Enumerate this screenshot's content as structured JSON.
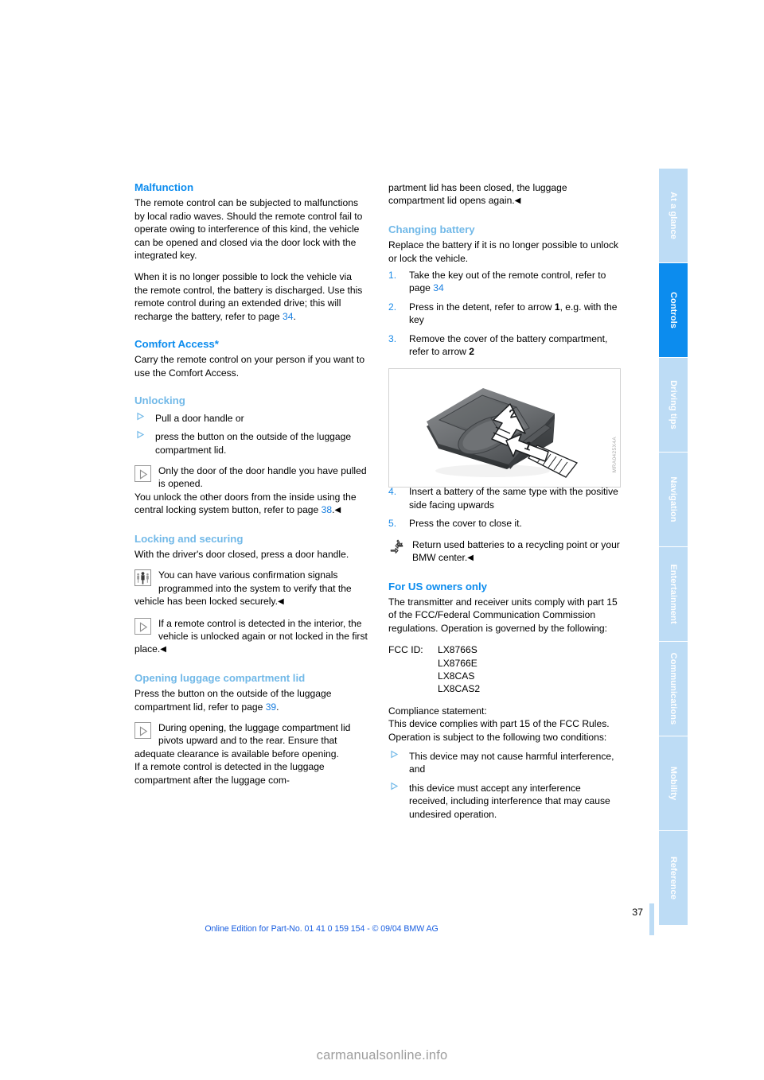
{
  "document": {
    "page_number": "37",
    "footer_note": "Online Edition for Part-No. 01 41 0 159 154 - © 09/04 BMW AG",
    "watermark": "carmanualsonline.info"
  },
  "colors": {
    "heading_primary": "#0c8cee",
    "heading_secondary": "#72b9e8",
    "page_ref_link": "#1a7fe0",
    "tab_active_bg": "#0c8cee",
    "tab_inactive_bg": "#bddcf5",
    "body_text": "#000000",
    "watermark": "#9d9d9d"
  },
  "sidebar": {
    "tabs": [
      {
        "label": "At a glance",
        "active": false
      },
      {
        "label": "Controls",
        "active": true
      },
      {
        "label": "Driving tips",
        "active": false
      },
      {
        "label": "Navigation",
        "active": false
      },
      {
        "label": "Entertainment",
        "active": false
      },
      {
        "label": "Communications",
        "active": false
      },
      {
        "label": "Mobility",
        "active": false
      },
      {
        "label": "Reference",
        "active": false
      }
    ]
  },
  "left_column": {
    "malfunction": {
      "heading": "Malfunction",
      "para1": "The remote control can be subjected to malfunctions by local radio waves. Should the remote control fail to operate owing to interference of this kind, the vehicle can be opened and closed via the door lock with the integrated key.",
      "para2_before": "When it is no longer possible to lock the vehicle via the remote control, the battery is discharged. Use this remote control during an extended drive; this will recharge the battery, refer to page ",
      "para2_page": "34",
      "para2_after": "."
    },
    "comfort_access": {
      "heading": "Comfort Access*",
      "para1": "Carry the remote control on your person if you want to use the Comfort Access."
    },
    "unlocking": {
      "heading": "Unlocking",
      "bullets": [
        "Pull a door handle or",
        "press the button on the outside of the luggage compartment lid."
      ],
      "note_icon": "note-triangle-icon",
      "note_text": "Only the door of the door handle you have pulled is opened.",
      "after_note_before": "You unlock the other doors from the inside using the central locking system button, refer to page ",
      "after_note_page": "38",
      "after_note_after": ".",
      "end_marker": "◀"
    },
    "locking": {
      "heading": "Locking and securing",
      "para1": "With the driver's door closed, press a door handle.",
      "note1_icon": "pedestrian-warning-icon",
      "note1_text": "You can have various confirmation signals programmed into the system to verify that the vehicle has been locked securely.",
      "note1_end_marker": "◀",
      "note2_icon": "note-triangle-icon",
      "note2_text": "If a remote control is detected in the interior, the vehicle is unlocked again or not locked in the first place.",
      "note2_end_marker": "◀"
    },
    "luggage_lid": {
      "heading": "Opening luggage compartment lid",
      "para1_before": "Press the button on the outside of the luggage compartment lid, refer to page ",
      "para1_page": "39",
      "para1_after": ".",
      "note_icon": "note-triangle-icon",
      "note_text": "During opening, the luggage compartment lid pivots upward and to the rear. Ensure that adequate clearance is available before opening.",
      "note_text_cont": "If a remote control is detected in the luggage compartment after the luggage com-"
    }
  },
  "right_column": {
    "continuation": {
      "text": "partment lid has been closed, the luggage compartment lid opens again.",
      "end_marker": "◀"
    },
    "changing_battery": {
      "heading": "Changing battery",
      "para1": "Replace the battery if it is no longer possible to unlock or lock the vehicle.",
      "steps": [
        {
          "num": "1.",
          "text_before": "Take the key out of the remote control, refer to page ",
          "page": "34",
          "text_after": ""
        },
        {
          "num": "2.",
          "text_before": "Press in the detent, refer to arrow ",
          "bold": "1",
          "text_after": ", e.g. with the key"
        },
        {
          "num": "3.",
          "text_before": "Remove the cover of the battery compartment, refer to arrow ",
          "bold": "2",
          "text_after": ""
        }
      ],
      "steps_after_figure": [
        {
          "num": "4.",
          "text": "Insert a battery of the same type with the positive side facing upwards"
        },
        {
          "num": "5.",
          "text": "Press the cover to close it."
        }
      ],
      "note_icon": "recycling-icon",
      "note_text": "Return used batteries to a recycling point or your BMW center.",
      "note_end_marker": "◀"
    },
    "figure": {
      "caption_code": "MRA0425X4A",
      "arrow_1_label": "1",
      "arrow_2_label": "2",
      "alt": "Remote control key fob with battery compartment cover, arrow 1 pressing detent, arrow 2 lifting cover"
    },
    "us_owners": {
      "heading": "For US owners only",
      "para1": "The transmitter and receiver units comply with part 15 of the FCC/Federal Communication Commission regulations. Operation is governed by the following:",
      "fcc_label": "FCC ID:",
      "fcc_ids": [
        "LX8766S",
        "LX8766E",
        "LX8CAS",
        "LX8CAS2"
      ],
      "compliance_heading": "Compliance statement:",
      "compliance_text": "This device complies with part 15 of the FCC Rules. Operation is subject to the following two conditions:",
      "conditions": [
        "This device may not cause harmful interference, and",
        "this device must accept any interference received, including interference that may cause undesired operation."
      ]
    }
  }
}
